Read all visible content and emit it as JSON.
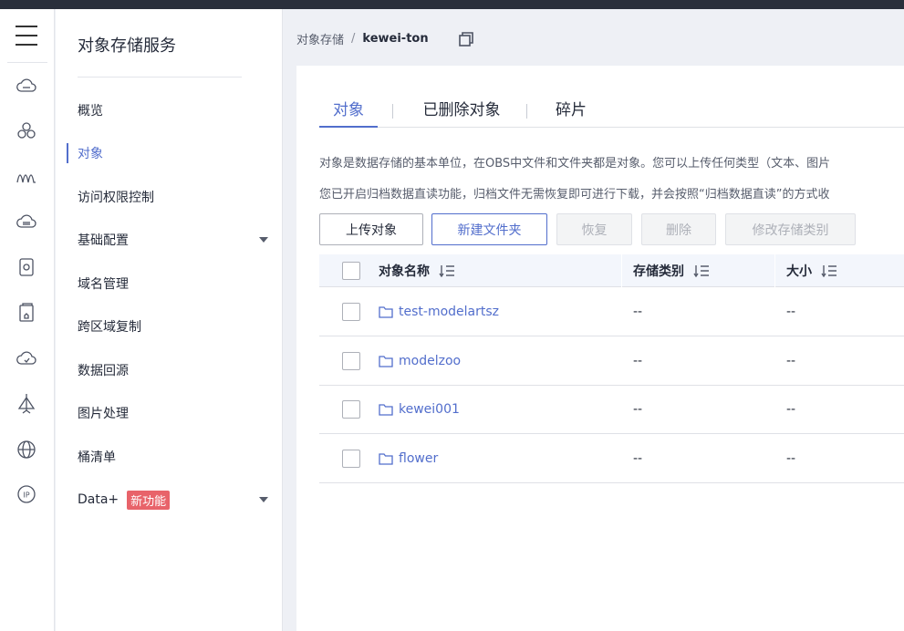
{
  "subnav": {
    "title": "对象存储服务",
    "items": [
      {
        "label": "概览",
        "active": false
      },
      {
        "label": "对象",
        "active": true
      },
      {
        "label": "访问权限控制",
        "active": false
      },
      {
        "label": "基础配置",
        "active": false,
        "expandable": true
      },
      {
        "label": "域名管理",
        "active": false
      },
      {
        "label": "跨区域复制",
        "active": false
      },
      {
        "label": "数据回源",
        "active": false
      },
      {
        "label": "图片处理",
        "active": false
      },
      {
        "label": "桶清单",
        "active": false
      },
      {
        "label": "Data+",
        "active": false,
        "expandable": true,
        "badge": "新功能"
      }
    ]
  },
  "icon_rail": [
    "menu-icon",
    "cloud-storage-icon",
    "cluster-icon",
    "signal-icon",
    "storage-disk-icon",
    "device-icon",
    "device-home-icon",
    "cloud-check-icon",
    "network-icon",
    "globe-icon",
    "ip-icon"
  ],
  "breadcrumb": {
    "root": "对象存储",
    "separator": "/",
    "current": "kewei-ton"
  },
  "tabs": [
    "对象",
    "已删除对象",
    "碎片"
  ],
  "description": [
    "对象是数据存储的基本单位，在OBS中文件和文件夹都是对象。您可以上传任何类型（文本、图片",
    "您已开启归档数据直读功能，归档文件无需恢复即可进行下载，并会按照“归档数据直读”的方式收"
  ],
  "toolbar": {
    "upload": "上传对象",
    "new_folder": "新建文件夹",
    "restore": "恢复",
    "delete": "删除",
    "change_storage_class": "修改存储类别"
  },
  "table": {
    "columns": [
      "对象名称",
      "存储类别",
      "大小"
    ],
    "rows": [
      {
        "name": "test-modelartsz",
        "storage_class": "--",
        "size": "--"
      },
      {
        "name": "modelzoo",
        "storage_class": "--",
        "size": "--"
      },
      {
        "name": "kewei001",
        "storage_class": "--",
        "size": "--"
      },
      {
        "name": "flower",
        "storage_class": "--",
        "size": "--"
      }
    ]
  },
  "colors": {
    "accent": "#526ecc",
    "badge": "#e8636a",
    "topbar": "#2a2f3b"
  }
}
